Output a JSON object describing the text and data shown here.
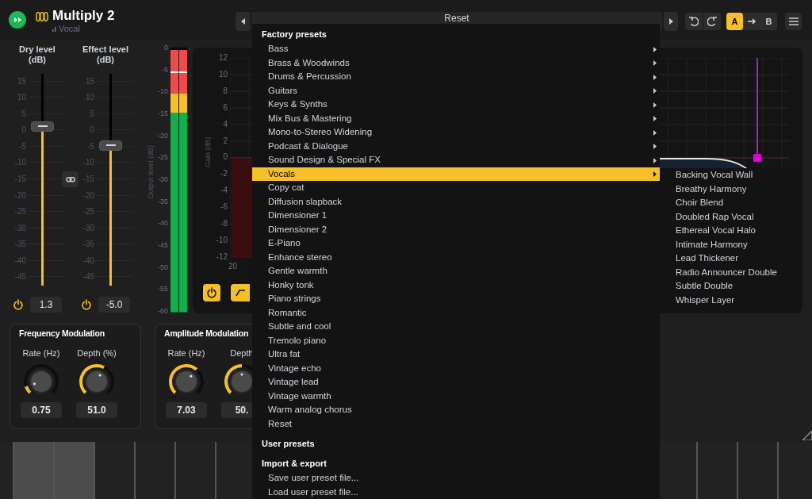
{
  "header": {
    "title": "Multiply 2",
    "subtitle": "Vocal",
    "preset_name": "Reset",
    "ab": [
      {
        "label": "A",
        "selected": true
      },
      {
        "label": "B",
        "selected": false
      }
    ]
  },
  "faders": [
    {
      "label": "Dry level (dB)",
      "ticks": [
        "15",
        "10",
        "5",
        "0",
        "-5",
        "-10",
        "-15",
        "-20",
        "-25",
        "-30",
        "-35",
        "-40",
        "-45"
      ],
      "level": 0.75,
      "value": "1.3",
      "on": true
    },
    {
      "label": "Effect level (dB)",
      "ticks": [
        "15",
        "10",
        "5",
        "0",
        "-5",
        "-10",
        "-15",
        "-20",
        "-25",
        "-30",
        "-35",
        "-40",
        "-45"
      ],
      "level": 0.66,
      "value": "-5.0",
      "on": true
    }
  ],
  "output_meter": {
    "axis_label": "Output level (dB)",
    "ticks": [
      "0",
      "-5",
      "-10",
      "-15",
      "-20",
      "-25",
      "-30",
      "-35",
      "-40",
      "-45",
      "-50",
      "-55",
      "-60"
    ],
    "channels": [
      {
        "level": 0.99
      },
      {
        "level": 0.99
      }
    ]
  },
  "eq": {
    "axis_label": "Gain (dB)",
    "yticks": [
      "12",
      "10",
      "8",
      "6",
      "4",
      "2",
      "0",
      "-2",
      "-4",
      "-6",
      "-8",
      "-10",
      "-12"
    ],
    "xtick": "20",
    "on": true
  },
  "modulation": [
    {
      "title": "Frequency Modulation",
      "knobs": [
        {
          "label": "Rate (Hz)",
          "level": 0.1,
          "value": "0.75"
        },
        {
          "label": "Depth (%)",
          "level": 0.6,
          "value": "51.0"
        }
      ]
    },
    {
      "title": "Amplitude Modulation",
      "knobs": [
        {
          "label": "Rate (Hz)",
          "level": 0.65,
          "value": "7.03"
        },
        {
          "label": "Depth",
          "level": 0.5,
          "value": "50."
        }
      ]
    }
  ],
  "keyboard": {
    "keys_left": [
      {
        "lit": false
      },
      {
        "lit": true
      },
      {
        "lit": true
      },
      {
        "lit": false
      },
      {
        "lit": false
      },
      {
        "lit": false
      },
      {
        "lit": false
      }
    ],
    "keys_right": [
      {
        "lit": false
      },
      {
        "lit": false
      },
      {
        "lit": false
      },
      {
        "lit": false
      }
    ]
  },
  "preset_menu": {
    "sections": [
      {
        "title": "Factory presets",
        "items": [
          {
            "label": "Bass",
            "has_submenu": true,
            "selected": false
          },
          {
            "label": "Brass & Woodwinds",
            "has_submenu": true,
            "selected": false
          },
          {
            "label": "Drums & Percussion",
            "has_submenu": true,
            "selected": false
          },
          {
            "label": "Guitars",
            "has_submenu": true,
            "selected": false
          },
          {
            "label": "Keys & Synths",
            "has_submenu": true,
            "selected": false
          },
          {
            "label": "Mix Bus & Mastering",
            "has_submenu": true,
            "selected": false
          },
          {
            "label": "Mono-to-Stereo Widening",
            "has_submenu": true,
            "selected": false
          },
          {
            "label": "Podcast & Dialogue",
            "has_submenu": true,
            "selected": false
          },
          {
            "label": "Sound Design & Special FX",
            "has_submenu": true,
            "selected": false
          },
          {
            "label": "Vocals",
            "has_submenu": true,
            "selected": true
          },
          {
            "label": "Copy cat",
            "has_submenu": false,
            "selected": false
          },
          {
            "label": "Diffusion slapback",
            "has_submenu": false,
            "selected": false
          },
          {
            "label": "Dimensioner 1",
            "has_submenu": false,
            "selected": false
          },
          {
            "label": "Dimensioner 2",
            "has_submenu": false,
            "selected": false
          },
          {
            "label": "E-Piano",
            "has_submenu": false,
            "selected": false
          },
          {
            "label": "Enhance stereo",
            "has_submenu": false,
            "selected": false
          },
          {
            "label": "Gentle warmth",
            "has_submenu": false,
            "selected": false
          },
          {
            "label": "Honky tonk",
            "has_submenu": false,
            "selected": false
          },
          {
            "label": "Piano strings",
            "has_submenu": false,
            "selected": false
          },
          {
            "label": "Romantic",
            "has_submenu": false,
            "selected": false
          },
          {
            "label": "Subtle and cool",
            "has_submenu": false,
            "selected": false
          },
          {
            "label": "Tremolo piano",
            "has_submenu": false,
            "selected": false
          },
          {
            "label": "Ultra fat",
            "has_submenu": false,
            "selected": false
          },
          {
            "label": "Vintage echo",
            "has_submenu": false,
            "selected": false
          },
          {
            "label": "Vintage lead",
            "has_submenu": false,
            "selected": false
          },
          {
            "label": "Vintage warmth",
            "has_submenu": false,
            "selected": false
          },
          {
            "label": "Warm analog chorus",
            "has_submenu": false,
            "selected": false
          },
          {
            "label": "Reset",
            "has_submenu": false,
            "selected": false
          }
        ]
      },
      {
        "title": "User presets"
      },
      {
        "title": "Import & export",
        "items": [
          {
            "label": "Save user preset file...",
            "has_submenu": false,
            "selected": false
          },
          {
            "label": "Load user preset file...",
            "has_submenu": false,
            "selected": false
          }
        ]
      }
    ]
  },
  "submenu": {
    "items": [
      {
        "label": "Backing Vocal Wall"
      },
      {
        "label": "Breathy Harmony"
      },
      {
        "label": "Choir Blend"
      },
      {
        "label": "Doubled Rap Vocal"
      },
      {
        "label": "Ethereal Vocal Halo"
      },
      {
        "label": "Intimate Harmony"
      },
      {
        "label": "Lead Thickener"
      },
      {
        "label": "Radio Announcer Double"
      },
      {
        "label": "Subtle Double"
      },
      {
        "label": "Whisper Layer"
      }
    ]
  }
}
